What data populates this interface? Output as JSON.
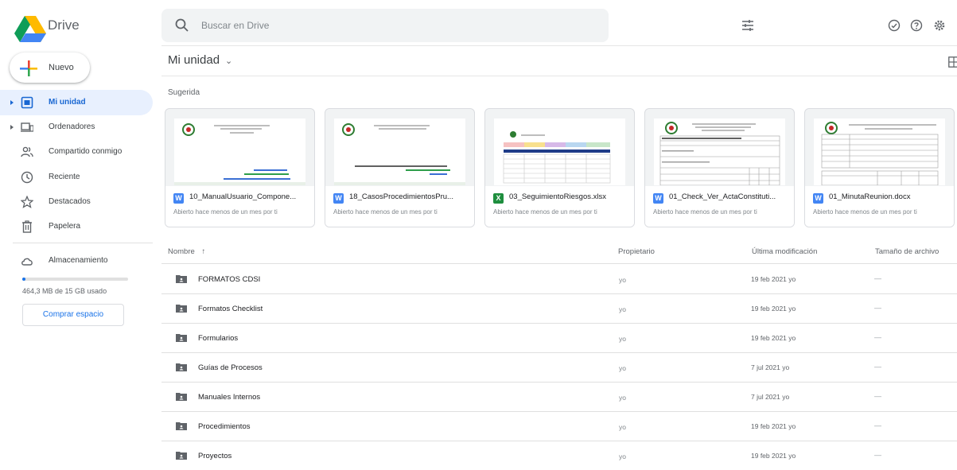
{
  "app": {
    "name": "Drive"
  },
  "search": {
    "placeholder": "Buscar en Drive"
  },
  "sidebar": {
    "new_label": "Nuevo",
    "items": [
      {
        "label": "Mi unidad"
      },
      {
        "label": "Ordenadores"
      },
      {
        "label": "Compartido conmigo"
      },
      {
        "label": "Reciente"
      },
      {
        "label": "Destacados"
      },
      {
        "label": "Papelera"
      }
    ],
    "storage": {
      "label": "Almacenamiento",
      "usage_text": "464,3 MB de 15 GB usado",
      "used_fraction": 0.03,
      "buy_label": "Comprar espacio"
    }
  },
  "main": {
    "title": "Mi unidad",
    "suggested_label": "Sugerida",
    "suggested": [
      {
        "type": "W",
        "name": "10_ManualUsuario_Compone...",
        "subtitle": "Abierto hace menos de un mes por ti"
      },
      {
        "type": "W",
        "name": "18_CasosProcedimientosPru...",
        "subtitle": "Abierto hace menos de un mes por ti"
      },
      {
        "type": "X",
        "name": "03_SeguimientoRiesgos.xlsx",
        "subtitle": "Abierto hace menos de un mes por ti"
      },
      {
        "type": "W",
        "name": "01_Check_Ver_ActaConstituti...",
        "subtitle": "Abierto hace menos de un mes por ti"
      },
      {
        "type": "W",
        "name": "01_MinutaReunion.docx",
        "subtitle": "Abierto hace menos de un mes por ti"
      }
    ],
    "columns": {
      "name": "Nombre",
      "owner": "Propietario",
      "modified": "Última modificación",
      "size": "Tamaño de archivo"
    },
    "rows": [
      {
        "name": "FORMATOS CDSI",
        "owner": "yo",
        "modified": "19 feb 2021 yo",
        "size": "—"
      },
      {
        "name": "Formatos Checklist",
        "owner": "yo",
        "modified": "19 feb 2021 yo",
        "size": "—"
      },
      {
        "name": "Formularios",
        "owner": "yo",
        "modified": "19 feb 2021 yo",
        "size": "—"
      },
      {
        "name": "Guías de Procesos",
        "owner": "yo",
        "modified": "7 jul 2021 yo",
        "size": "—"
      },
      {
        "name": "Manuales Internos",
        "owner": "yo",
        "modified": "7 jul 2021 yo",
        "size": "—"
      },
      {
        "name": "Procedimientos",
        "owner": "yo",
        "modified": "19 feb 2021 yo",
        "size": "—"
      },
      {
        "name": "Proyectos",
        "owner": "yo",
        "modified": "19 feb 2021 yo",
        "size": "—"
      }
    ]
  },
  "colors": {
    "accent": "#1a73e8",
    "word": "#4285f4",
    "excel": "#1e8e3e",
    "folder": "#5f6368"
  }
}
